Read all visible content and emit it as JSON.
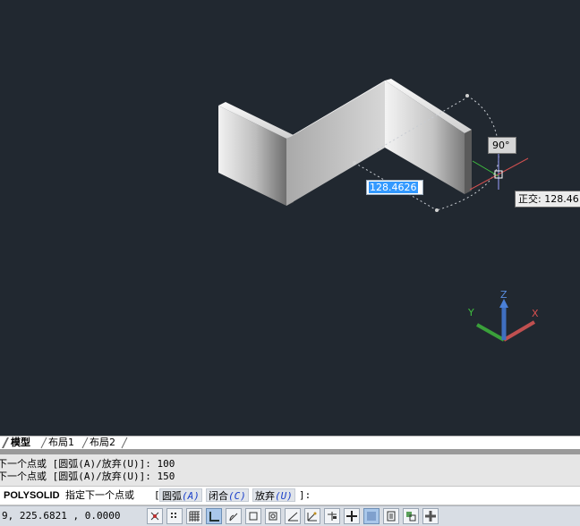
{
  "viewport": {
    "dynamic_input_value": "128.4626",
    "angle_tooltip": "90°",
    "ortho_tooltip": "正交: 128.46",
    "ucs_axes": {
      "x": "X",
      "y": "Y",
      "z": "Z"
    },
    "background_color": "#212830"
  },
  "tabs": [
    {
      "label": "模型",
      "active": true
    },
    {
      "label": "布局1",
      "active": false
    },
    {
      "label": "布局2",
      "active": false
    }
  ],
  "command_history": [
    "下一个点或 [圆弧(A)/放弃(U)]: 100",
    "下一个点或 [圆弧(A)/放弃(U)]: 150"
  ],
  "command_line": {
    "command": "POLYSOLID",
    "prompt": "指定下一个点或",
    "bracket_open": "[",
    "options": [
      {
        "label": "圆弧",
        "key": "(A)"
      },
      {
        "label": "闭合",
        "key": "(C)"
      },
      {
        "label": "放弃",
        "key": "(U)"
      }
    ],
    "suffix": "]:"
  },
  "status_bar": {
    "coordinates": "9,  225.6821 , 0.0000",
    "buttons": [
      {
        "name": "infer-constraints",
        "on": false
      },
      {
        "name": "snap-mode",
        "on": false
      },
      {
        "name": "grid-display",
        "on": false
      },
      {
        "name": "ortho-mode",
        "on": true
      },
      {
        "name": "polar-tracking",
        "on": false
      },
      {
        "name": "object-snap",
        "on": false
      },
      {
        "name": "3d-object-snap",
        "on": false
      },
      {
        "name": "object-snap-tracking",
        "on": false
      },
      {
        "name": "dynamic-ucs",
        "on": false
      },
      {
        "name": "dynamic-input",
        "on": false
      },
      {
        "name": "lineweight",
        "on": false
      },
      {
        "name": "transparency",
        "on": true
      },
      {
        "name": "quick-properties",
        "on": false
      },
      {
        "name": "selection-cycling",
        "on": false
      },
      {
        "name": "annotation-monitor",
        "on": false
      }
    ]
  },
  "annotation": {
    "arrow_color": "#ff3b30"
  }
}
